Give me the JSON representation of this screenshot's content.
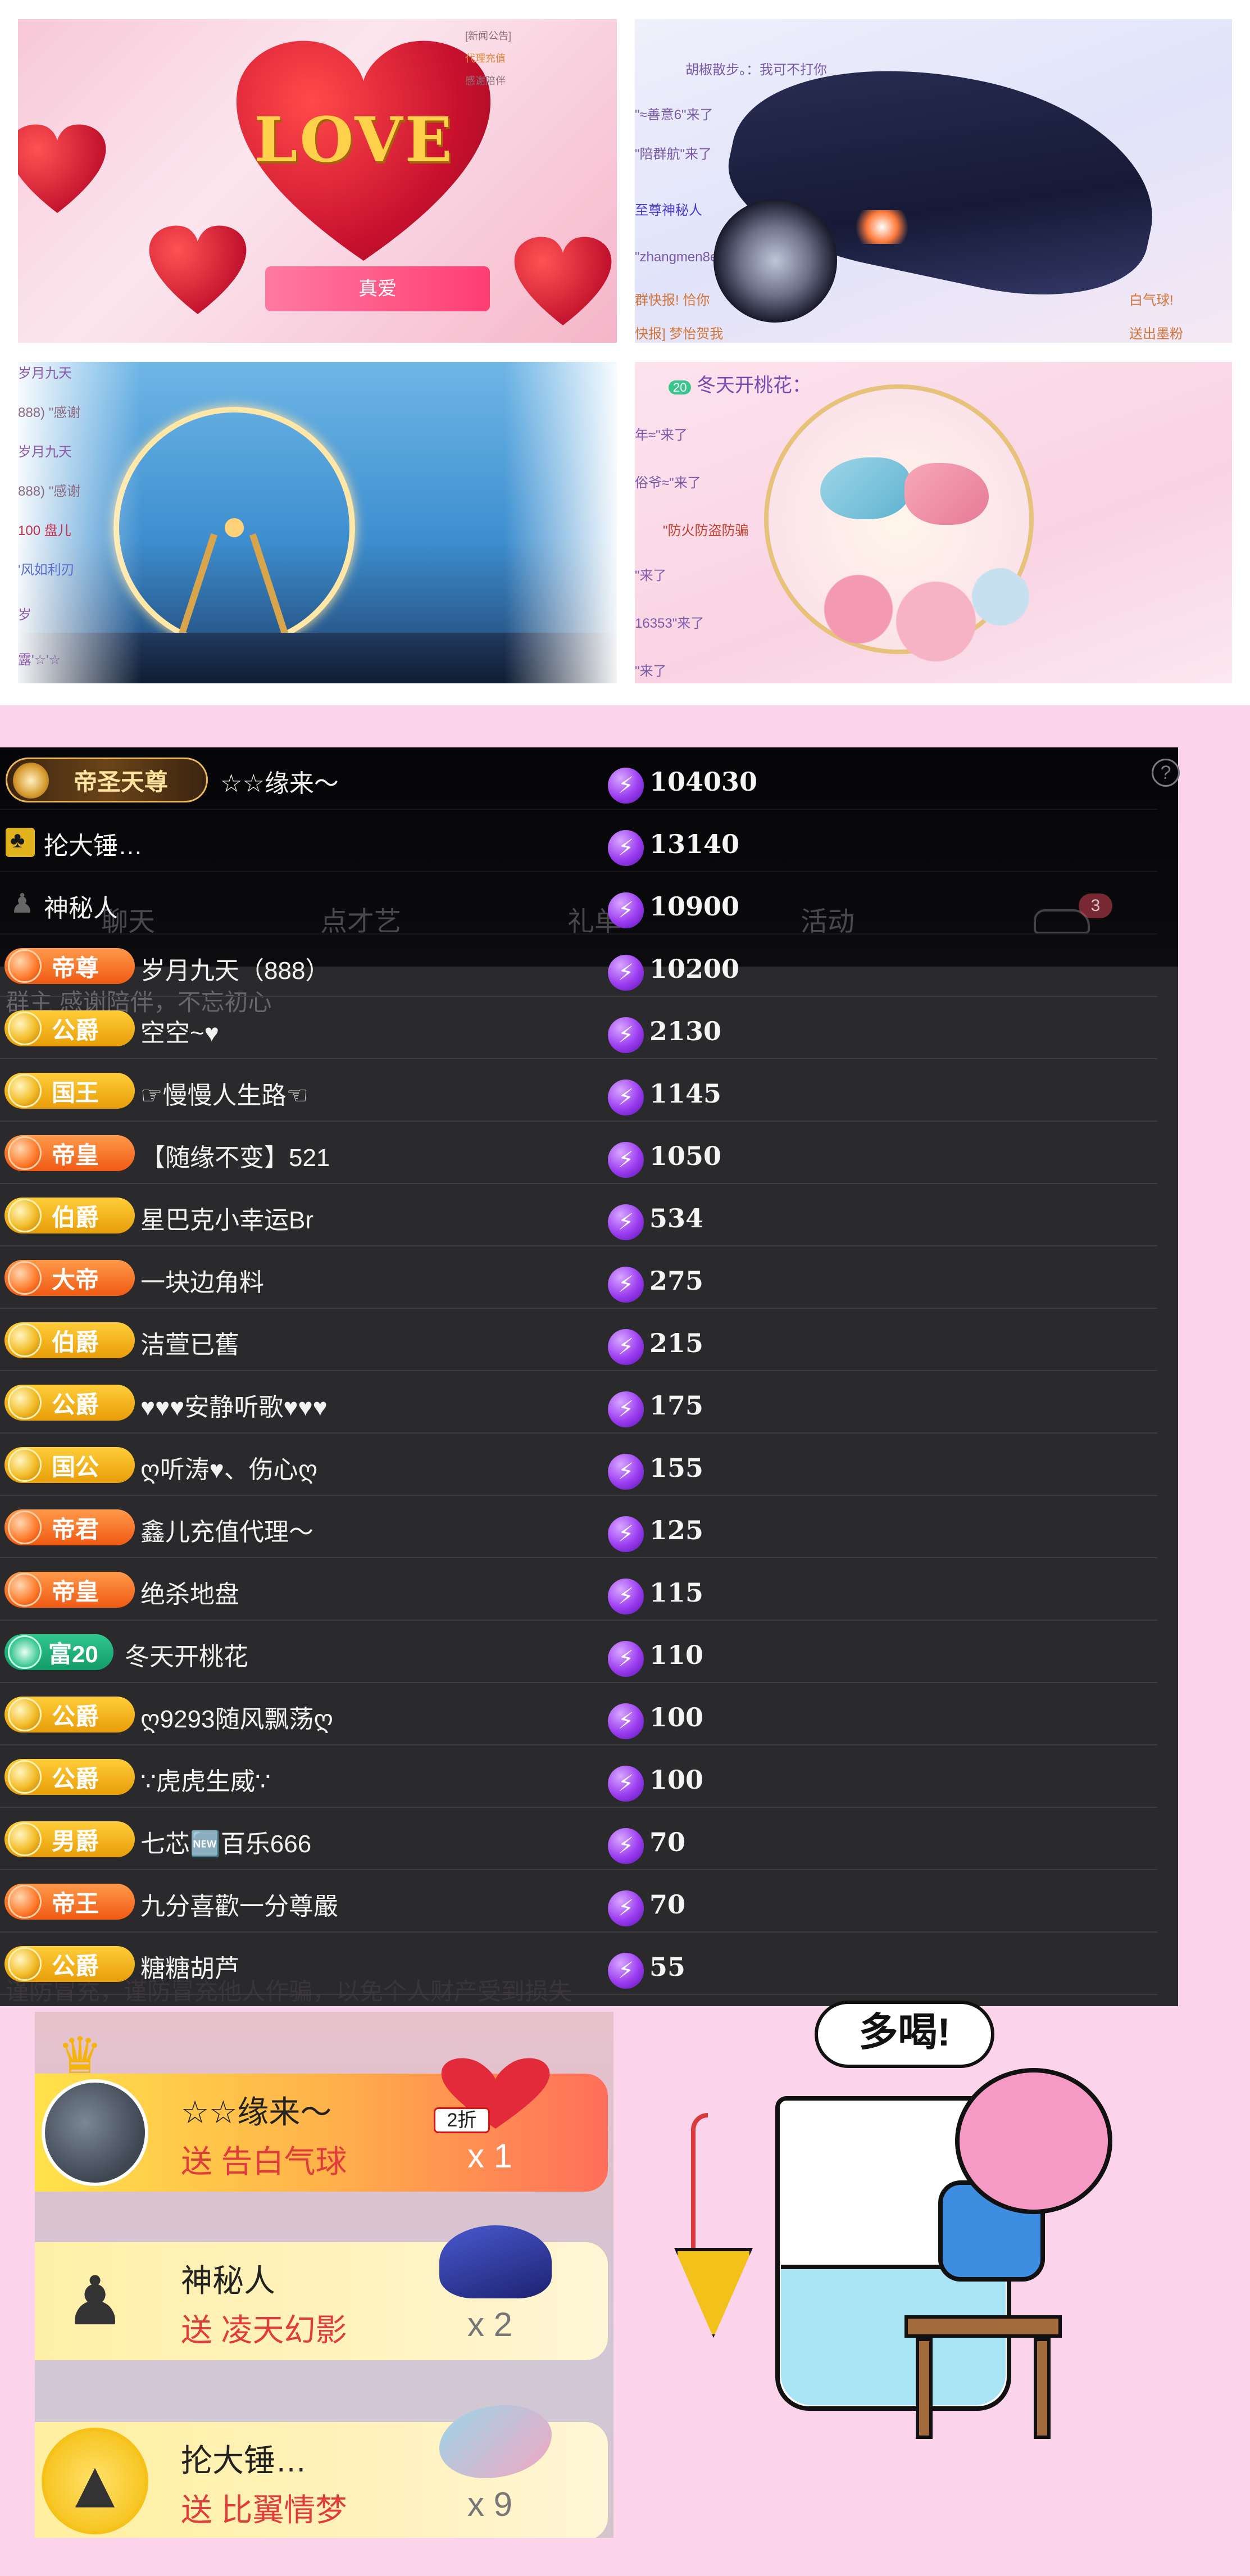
{
  "collage": {
    "love_tile": {
      "banner": "LOVE",
      "badge_label": "真爱",
      "side_lines": [
        "[新闻公告] ",
        "代理充值",
        "感谢陪伴"
      ]
    },
    "car_tile": {
      "chat_lines": [
        "胡椒散步。：我可不打你",
        "\"≈善意6\"来了",
        "\"陪群航\"来了",
        "至尊神秘人",
        "\"zhangmen8e\"",
        "群快报! 恰你",
        "快报] 梦怡贺我",
        "白气球!",
        "送出墨粉"
      ]
    },
    "wheel_tile": {
      "chat_lines": [
        "岁月九天",
        "888) \"感谢",
        "岁月九天",
        "888) \"感谢",
        "100  盘儿",
        "'风如利刃",
        "岁",
        "露'☆'☆"
      ]
    },
    "bird_tile": {
      "header": "冬天开桃花：",
      "header_level": "20",
      "chat_lines": [
        "年≈\"来了",
        "俗爷≈\"来了",
        "\"防火防盗防骗",
        "\"来了",
        "16353\"来了",
        "\"来了"
      ]
    }
  },
  "board": {
    "ghost_tabs": [
      "聊天",
      "点才艺",
      "礼单",
      "活动"
    ],
    "ghost_badge": "3",
    "ghost_subtitle": "群主 感谢陪伴，不忘初心",
    "ghost_footer": "谨防冒充，谨防冒充他人作骗，以免个人财产受到损失",
    "help_label": "?",
    "coin_glyph": "⚡",
    "rows": [
      {
        "badge_type": "emperor",
        "badge": "帝圣天尊",
        "name": "☆☆缘来～",
        "score": "104030"
      },
      {
        "badge_type": "hammer",
        "badge": "",
        "name": "抡大锤…",
        "score": "13140"
      },
      {
        "badge_type": "mystery",
        "badge": "",
        "name": "神秘人",
        "score": "10900"
      },
      {
        "badge_type": "orange",
        "badge": "帝尊",
        "name": "岁月九天（888）",
        "score": "10200"
      },
      {
        "badge_type": "gold",
        "badge": "公爵",
        "name": "空空~♥",
        "score": "2130"
      },
      {
        "badge_type": "gold",
        "badge": "国王",
        "name": "☞慢慢人生路☜",
        "score": "1145"
      },
      {
        "badge_type": "orange",
        "badge": "帝皇",
        "name": "【随缘不变】521",
        "score": "1050"
      },
      {
        "badge_type": "gold",
        "badge": "伯爵",
        "name": "星巴克小幸运Br",
        "score": "534"
      },
      {
        "badge_type": "orange",
        "badge": "大帝",
        "name": "一块边角料",
        "score": "275"
      },
      {
        "badge_type": "gold",
        "badge": "伯爵",
        "name": "洁萱已舊",
        "score": "215"
      },
      {
        "badge_type": "gold",
        "badge": "公爵",
        "name": "♥♥♥安静听歌♥♥♥",
        "score": "175"
      },
      {
        "badge_type": "gold",
        "badge": "国公",
        "name": "ღ听涛♥、伤心ღ",
        "score": "155"
      },
      {
        "badge_type": "orange",
        "badge": "帝君",
        "name": "鑫儿充值代理～",
        "score": "125"
      },
      {
        "badge_type": "orange",
        "badge": "帝皇",
        "name": "绝杀地盘",
        "score": "115"
      },
      {
        "badge_type": "green",
        "badge": "富20",
        "name": "冬天开桃花",
        "score": "110"
      },
      {
        "badge_type": "gold",
        "badge": "公爵",
        "name": "ღ9293随风飘荡ღ",
        "score": "100"
      },
      {
        "badge_type": "gold",
        "badge": "公爵",
        "name": "∵虎虎生威∵",
        "score": "100"
      },
      {
        "badge_type": "gold",
        "badge": "男爵",
        "name": "七芯🆕百乐666",
        "score": "70"
      },
      {
        "badge_type": "orange",
        "badge": "帝王",
        "name": "九分喜歡一分尊嚴",
        "score": "70"
      },
      {
        "badge_type": "gold",
        "badge": "公爵",
        "name": "糖糖胡芦",
        "score": "55"
      }
    ]
  },
  "gifts": [
    {
      "user": "☆☆缘来～",
      "action": "送 告白气球",
      "count": "x 1",
      "tag": "2折"
    },
    {
      "user": "神秘人",
      "action": "送 凌天幻影",
      "count": "x 2"
    },
    {
      "user": "抡大锤…",
      "action": "送 比翼情梦",
      "count": "x 9"
    }
  ],
  "sticker": {
    "bubble_text": "多喝!"
  },
  "colors": {
    "page_background": "#fbd3ea",
    "board_background": "#2a2a2c",
    "score_coin": "#9b3df0",
    "gift_action": "#e23b3b"
  }
}
